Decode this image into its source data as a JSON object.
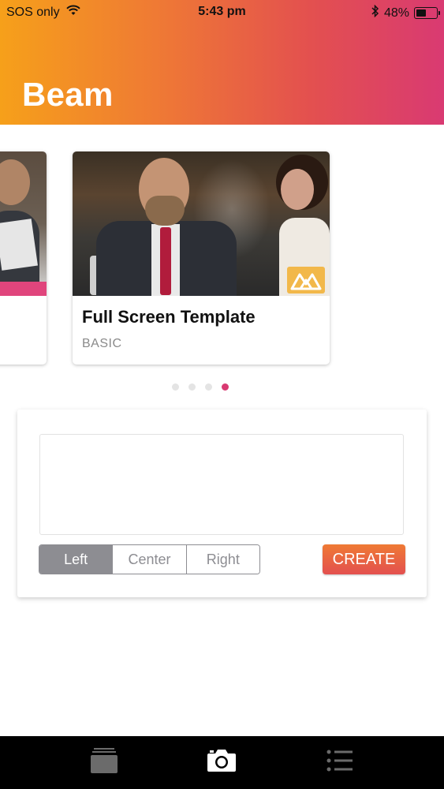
{
  "status_bar": {
    "carrier": "SOS only",
    "time": "5:43 pm",
    "battery": "48%",
    "battery_fraction": 0.48
  },
  "app": {
    "title": "Beam"
  },
  "carousel": {
    "card": {
      "title": "Full Screen Template",
      "subtitle": "BASIC"
    },
    "page_count": 4,
    "active_page": 4
  },
  "editor": {
    "text_value": "",
    "alignment_options": [
      "Left",
      "Center",
      "Right"
    ],
    "selected_alignment": "Left",
    "create_label": "CREATE"
  },
  "tabbar": {
    "items": [
      {
        "icon": "stack-icon"
      },
      {
        "icon": "camera-icon"
      },
      {
        "icon": "list-icon"
      }
    ]
  },
  "colors": {
    "gradient_start": "#f6a01a",
    "gradient_end": "#d93a72",
    "accent": "#d93a72",
    "segment_gray": "#8d8d92"
  }
}
